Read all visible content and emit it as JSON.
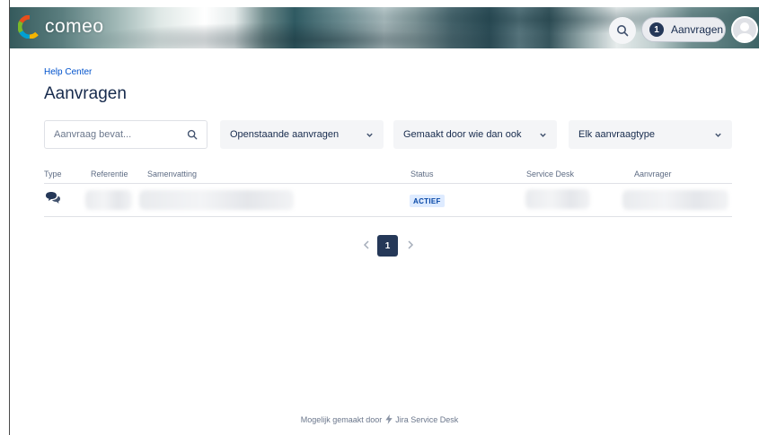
{
  "header": {
    "logo_text": "comeo",
    "requests_count": "1",
    "requests_label": "Aanvragen",
    "icons": {
      "search": "search-icon",
      "avatar": "user-avatar-icon",
      "logo": "comeo-logo-mark"
    },
    "colors": {
      "badge": "#253858",
      "logo_segments": [
        "#e84e1b",
        "#7ab929",
        "#00a0d2",
        "#f4b400"
      ]
    }
  },
  "breadcrumb": "Help Center",
  "page_title": "Aanvragen",
  "filters": {
    "search_placeholder": "Aanvraag bevat...",
    "status_select": "Openstaande aanvragen",
    "creator_select": "Gemaakt door wie dan ook",
    "type_select": "Elk aanvraagtype"
  },
  "table": {
    "columns": [
      "Type",
      "Referentie",
      "Samenvatting",
      "Status",
      "Service Desk",
      "Aanvrager"
    ],
    "rows": [
      {
        "type_icon": "speech-bubbles-icon",
        "status": "ACTIEF"
      }
    ]
  },
  "pagination": {
    "current": "1"
  },
  "footer": {
    "powered_by": "Mogelijk gemaakt door",
    "product": "Jira Service Desk",
    "colors": {
      "accent": "#0052cc"
    }
  }
}
